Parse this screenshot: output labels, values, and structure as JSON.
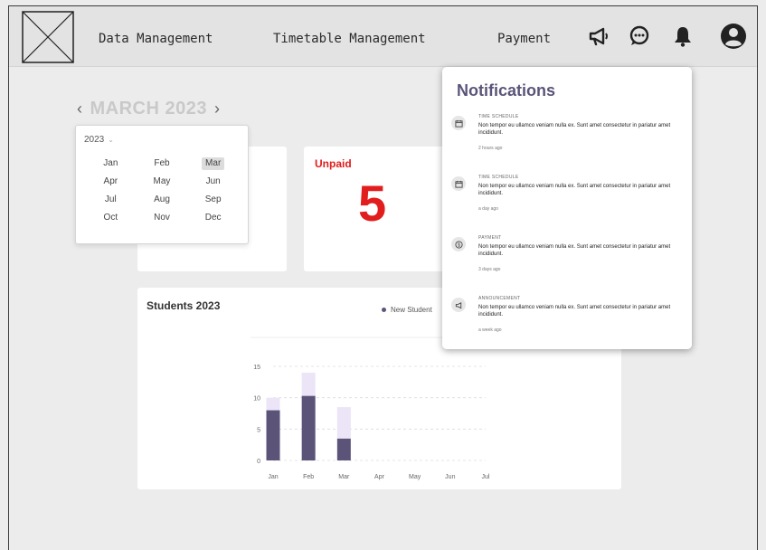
{
  "nav": {
    "links": [
      "Data Management",
      "Timetable Management",
      "Payment"
    ]
  },
  "calendar": {
    "month_label": "MARCH 2023",
    "prev": "‹",
    "next": "›"
  },
  "picker": {
    "year": "2023",
    "months": [
      "Jan",
      "Feb",
      "Mar",
      "Apr",
      "May",
      "Jun",
      "Jul",
      "Aug",
      "Sep",
      "Oct",
      "Nov",
      "Dec"
    ],
    "selected": "Mar"
  },
  "unpaid": {
    "label": "Unpaid",
    "value": "5"
  },
  "chart_data": {
    "type": "bar",
    "title": "Students 2023",
    "categories": [
      "Jan",
      "Feb",
      "Mar",
      "Apr",
      "May",
      "Jun",
      "Jul"
    ],
    "series": [
      {
        "name": "New Student",
        "values": [
          8,
          10.3,
          3.5,
          0,
          0,
          0,
          0
        ]
      },
      {
        "name": "",
        "values": [
          2,
          3.7,
          5,
          0,
          0,
          0,
          0
        ]
      }
    ],
    "yticks": [
      "0",
      "5",
      "10",
      "15"
    ],
    "ylim": [
      0,
      15
    ],
    "colors": [
      "#5b5478",
      "#ece4f7"
    ],
    "legend": "top-right"
  },
  "notifications": {
    "title": "Notifications",
    "items": [
      {
        "icon": "calendar-icon",
        "category": "TIME SCHEDULE",
        "body": "Non tempor eu ullamco veniam nulla ex. Sunt amet consectetur in pariatur amet incididunt.",
        "time": "2 hours ago"
      },
      {
        "icon": "calendar-icon",
        "category": "TIME SCHEDULE",
        "body": "Non tempor eu ullamco veniam nulla ex. Sunt amet consectetur in pariatur amet incididunt.",
        "time": "a day ago"
      },
      {
        "icon": "dollar-icon",
        "category": "PAYMENT",
        "body": "Non tempor eu ullamco veniam nulla ex. Sunt amet consectetur in pariatur amet incididunt.",
        "time": "3 days ago"
      },
      {
        "icon": "megaphone-icon",
        "category": "ANNOUNCEMENT",
        "body": "Non tempor eu ullamco veniam nulla ex. Sunt amet consectetur in pariatur amet incididunt.",
        "time": "a week ago"
      }
    ]
  },
  "colors": {
    "accent": "#5b5478",
    "danger": "#e21d1d",
    "bar_light": "#ece4f7"
  }
}
